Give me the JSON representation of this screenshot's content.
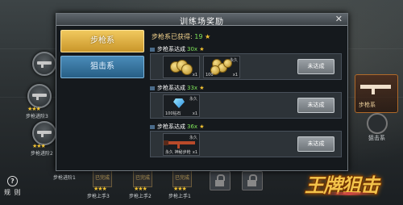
{
  "modal": {
    "title": "训练场奖励",
    "close_glyph": "✕",
    "tabs": [
      {
        "label": "步枪系",
        "active": true
      },
      {
        "label": "狙击系",
        "active": false
      }
    ],
    "obtained_label": "步枪系已获得: ",
    "obtained_count": "19",
    "star_glyph": "★",
    "rewards": [
      {
        "title": "步枪系达成",
        "count": "30x",
        "items": [
          {
            "icon": "gold-coin-stack-icon",
            "permanent": "",
            "caption": "",
            "qty": "x1"
          },
          {
            "icon": "gold-coin-pile-icon",
            "permanent": "永久",
            "caption": "100",
            "qty": "x1"
          }
        ],
        "button": "未达成"
      },
      {
        "title": "步枪系达成",
        "count": "33x",
        "items": [
          {
            "icon": "diamond-icon",
            "permanent": "永久",
            "caption": "100钻石",
            "qty": "x1"
          }
        ],
        "button": "未达成"
      },
      {
        "title": "步枪系达成",
        "count": "36x",
        "items": [
          {
            "icon": "rifle-icon",
            "permanent": "永久",
            "caption": "永久 神秘步枪",
            "qty": "x1"
          }
        ],
        "button": "未达成"
      }
    ]
  },
  "background": {
    "left_nodes": [
      {
        "label": "步枪进阶3"
      },
      {
        "label": "步枪进阶2"
      },
      {
        "label": "步枪进阶1"
      }
    ],
    "bottom_labels": [
      "步枪进阶1",
      "步枪上手3",
      "步枪上手2",
      "步枪上手1"
    ],
    "tiles": [
      "已完成",
      "已完成",
      "已完成"
    ],
    "help_icon": "?",
    "help_label": "规 则",
    "right_card_label": "步枪系",
    "right_label2": "狙击系",
    "logo_text": "王牌狙击"
  },
  "colors": {
    "tab_active": "#e6b540",
    "tab_idle": "#3c7aa6",
    "count_green": "#7fe45a",
    "star_gold": "#f1c232"
  }
}
